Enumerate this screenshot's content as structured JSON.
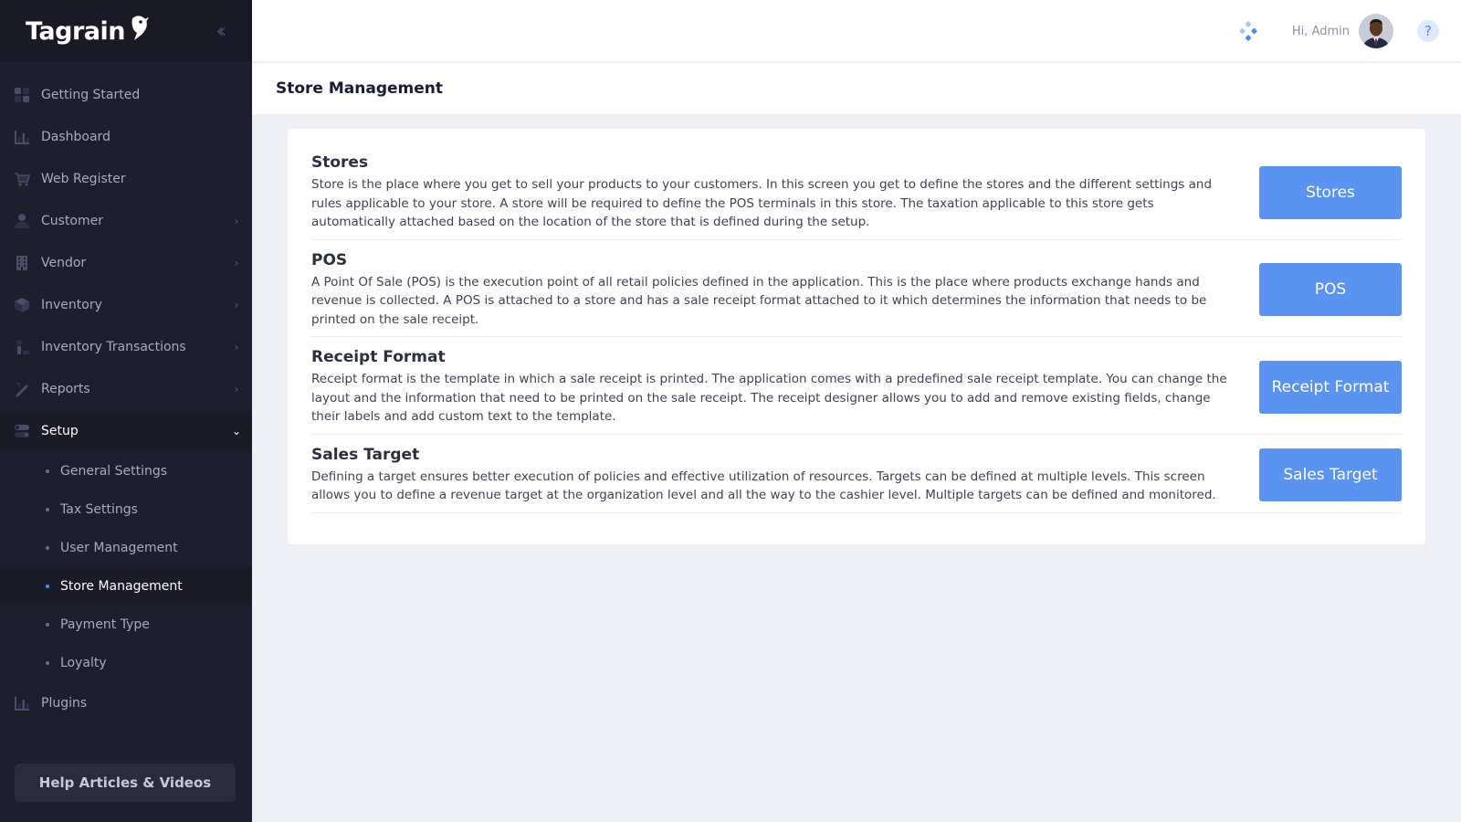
{
  "brand": {
    "name": "Tagrain"
  },
  "sidebar": {
    "items": [
      {
        "label": "Getting Started",
        "icon": "grid-icon"
      },
      {
        "label": "Dashboard",
        "icon": "bar-chart-icon"
      },
      {
        "label": "Web Register",
        "icon": "cart-icon"
      },
      {
        "label": "Customer",
        "icon": "user-icon"
      },
      {
        "label": "Vendor",
        "icon": "building-icon"
      },
      {
        "label": "Inventory",
        "icon": "box-icon"
      },
      {
        "label": "Inventory Transactions",
        "icon": "transactions-icon"
      },
      {
        "label": "Reports",
        "icon": "pencil-ruler-icon"
      },
      {
        "label": "Setup",
        "icon": "toggle-icon"
      },
      {
        "label": "Plugins",
        "icon": "bar-chart-icon"
      }
    ],
    "setup_sub": [
      {
        "label": "General Settings"
      },
      {
        "label": "Tax Settings"
      },
      {
        "label": "User Management"
      },
      {
        "label": "Store Management"
      },
      {
        "label": "Payment Type"
      },
      {
        "label": "Loyalty"
      }
    ],
    "help_button": "Help Articles & Videos"
  },
  "header": {
    "greeting": "Hi, Admin",
    "help_glyph": "?"
  },
  "page": {
    "title": "Store Management"
  },
  "sections": [
    {
      "title": "Stores",
      "description": "Store is the place where you get to sell your products to your customers. In this screen you get to define the stores and the different settings and rules applicable to your store. A store will be required to define the POS terminals in this store. The taxation applicable to this store gets automatically attached based on the location of the store that is defined during the setup.",
      "button": "Stores"
    },
    {
      "title": "POS",
      "description": "A Point Of Sale (POS) is the execution point of all retail policies defined in the application. This is the place where products exchange hands and revenue is collected. A POS is attached to a store and has a sale receipt format attached to it which determines the information that needs to be printed on the sale receipt.",
      "button": "POS"
    },
    {
      "title": "Receipt Format",
      "description": "Receipt format is the template in which a sale receipt is printed. The application comes with a predefined sale receipt template. You can change the layout and the information that need to be printed on the sale receipt. The receipt designer allows you to add and remove existing fields, change their labels and add custom text to the template.",
      "button": "Receipt Format"
    },
    {
      "title": "Sales Target",
      "description": "Defining a target ensures better execution of policies and effective utilization of resources. Targets can be defined at multiple levels. This screen allows you to define a revenue target at the organization level and all the way to the cashier level. Multiple targets can be defined and monitored.",
      "button": "Sales Target"
    }
  ],
  "colors": {
    "sidebar_bg": "#1e1e2d",
    "accent": "#3f8ff5",
    "button_bg": "#5b93f2"
  }
}
